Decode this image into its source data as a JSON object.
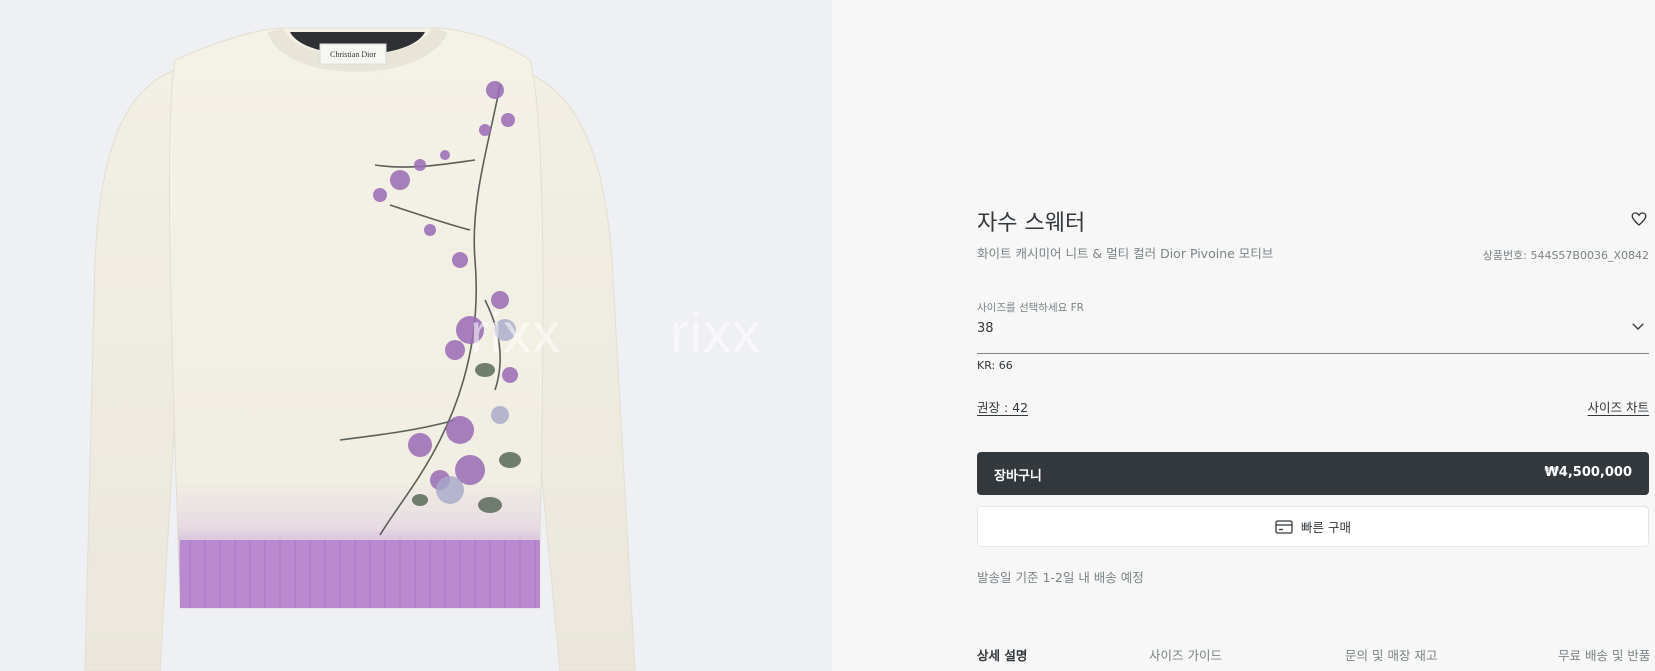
{
  "brand_label": "Christian Dior",
  "watermark": [
    "rixx",
    "rixx",
    "rixx",
    "rixx"
  ],
  "product": {
    "title": "자수 스웨터",
    "subtitle": "화이트 캐시미어 니트 & 멀티 컬러 Dior Pivoine 모티브",
    "reference": "상품번호: 544S57B0036_X0842"
  },
  "size": {
    "label": "사이즈를 선택하세요 FR",
    "value": "38",
    "kr": "KR: 66",
    "recommended": "권장 : 42",
    "chart_link": "사이즈 차트"
  },
  "cart": {
    "label": "장바구니",
    "price": "₩4,500,000"
  },
  "quick_buy": {
    "label": "빠른 구매",
    "icon": "credit-card-icon"
  },
  "shipping": "발송일 기준 1-2일 내 배송 예정",
  "tabs": [
    {
      "label": "상세 설명",
      "active": true
    },
    {
      "label": "사이즈 가이드",
      "active": false
    },
    {
      "label": "문의 및 매장 재고",
      "active": false
    },
    {
      "label": "무료 배송 및 반품",
      "active": false
    }
  ],
  "colors": {
    "dark": "#33383c",
    "muted": "#7b8487",
    "lilac": "#b98ad0"
  }
}
